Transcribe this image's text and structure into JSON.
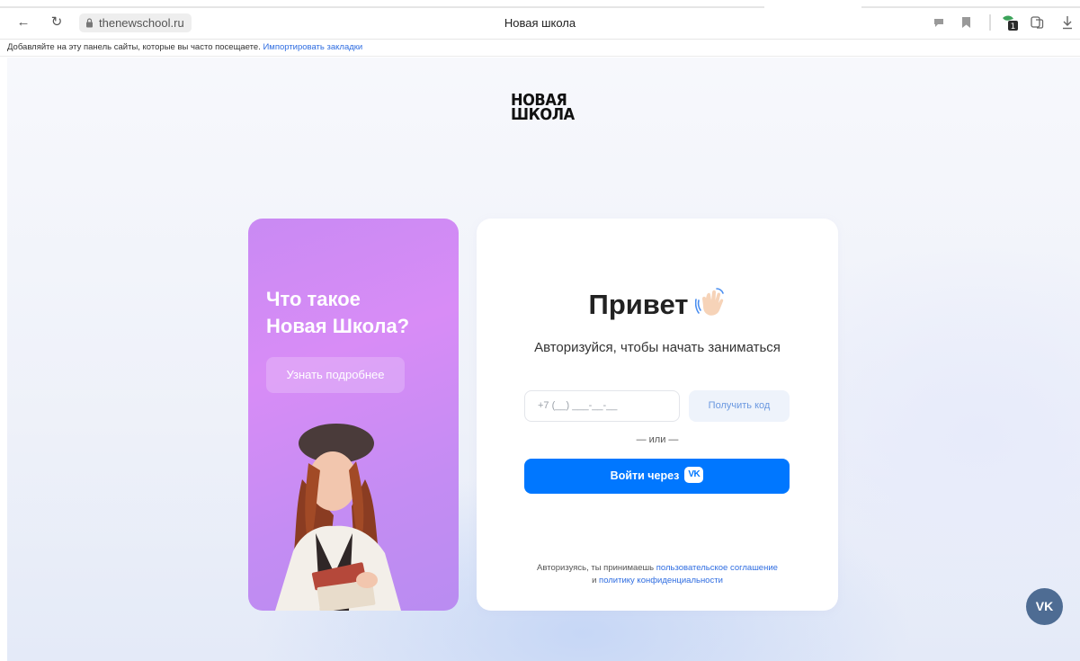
{
  "browser": {
    "url": "thenewschool.ru",
    "tab_title": "Новая школа",
    "bookmarks_prompt": "Добавляйте на эту панель сайты, которые вы часто посещаете.",
    "bookmarks_import": "Импортировать закладки"
  },
  "page": {
    "logo_line1": "НОВАЯ",
    "logo_line2": "ШКОЛА",
    "promo": {
      "title_line1": "Что такое",
      "title_line2": "Новая Школа?",
      "button": "Узнать подробнее"
    },
    "auth": {
      "greeting": "Привет",
      "subtitle": "Авторизуйся, чтобы начать заниматься",
      "phone_placeholder": "+7 (__) ___-__-__",
      "get_code": "Получить код",
      "or": "— или —",
      "vk_login": "Войти через",
      "vk_badge": "VK",
      "terms_prefix": "Авторизуясь, ты принимаешь",
      "terms_link1": "пользовательское соглашение",
      "terms_and": "и",
      "terms_link2": "политику конфиденциальности"
    },
    "vk_widget": "VK"
  },
  "colors": {
    "accent": "#0077ff",
    "promo_bg": "#d08cf5",
    "vk_widget": "#4e6c93"
  }
}
